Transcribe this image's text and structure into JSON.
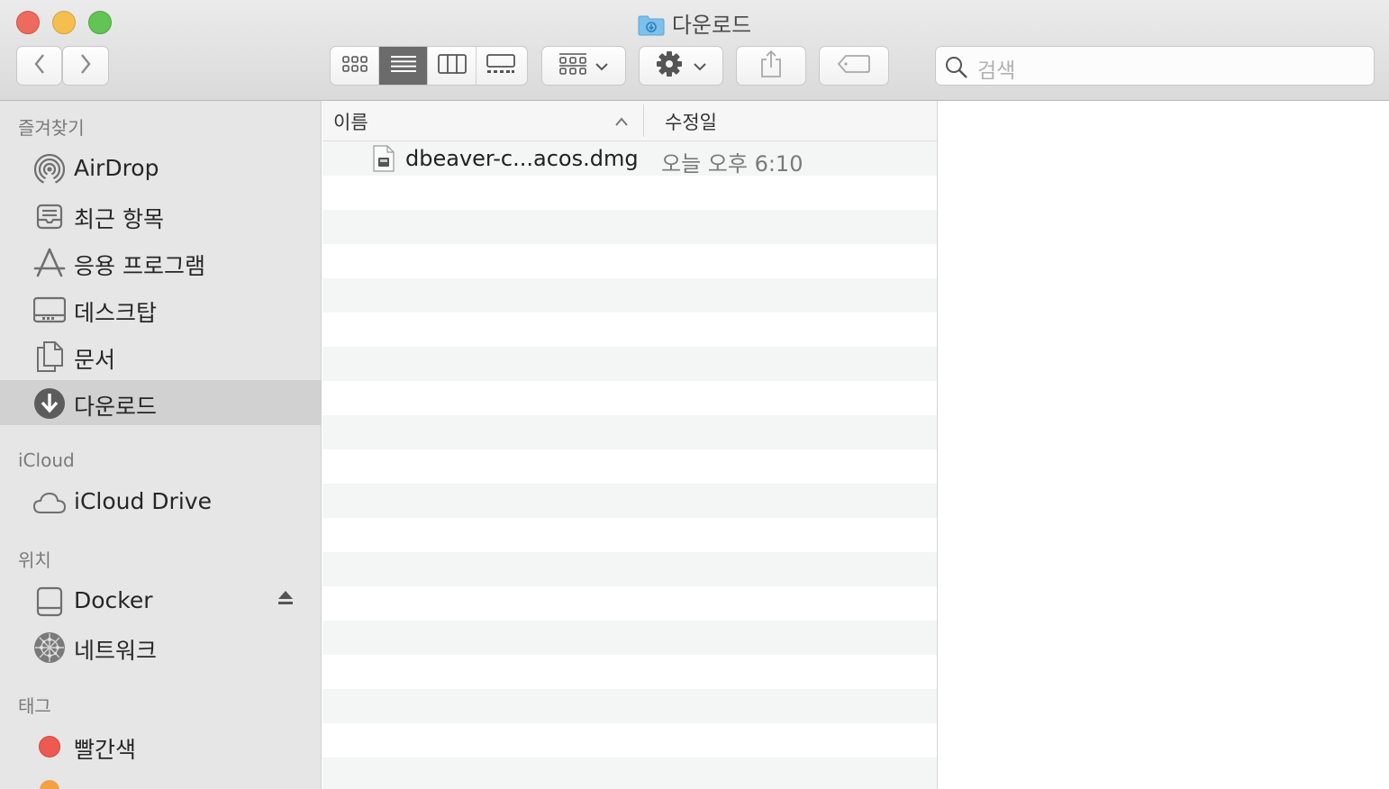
{
  "window": {
    "title": "다운로드"
  },
  "toolbar": {
    "nav": {
      "back_icon": "chevron-left-icon",
      "forward_icon": "chevron-right-icon"
    },
    "view_modes": [
      "icon-view-icon",
      "list-view-icon",
      "column-view-icon",
      "gallery-view-icon"
    ],
    "active_view": "list",
    "search_placeholder": "검색"
  },
  "sidebar": {
    "sections": {
      "favorites": "즐겨찾기",
      "icloud": "iCloud",
      "locations": "위치",
      "tags": "태그"
    },
    "favorites": [
      {
        "label": "AirDrop",
        "icon": "airdrop-icon"
      },
      {
        "label": "최근 항목",
        "icon": "recents-icon"
      },
      {
        "label": "응용 프로그램",
        "icon": "applications-icon"
      },
      {
        "label": "데스크탑",
        "icon": "desktop-icon"
      },
      {
        "label": "문서",
        "icon": "documents-icon"
      },
      {
        "label": "다운로드",
        "icon": "downloads-icon",
        "selected": true
      }
    ],
    "icloud": [
      {
        "label": "iCloud Drive",
        "icon": "cloud-icon"
      }
    ],
    "locations": [
      {
        "label": "Docker",
        "icon": "disk-icon"
      },
      {
        "label": "네트워크",
        "icon": "network-icon"
      }
    ],
    "tags": [
      {
        "label": "빨간색",
        "color": "#ee5a52"
      }
    ]
  },
  "list": {
    "columns": {
      "name": "이름",
      "modified": "수정일"
    },
    "files": [
      {
        "name": "dbeaver-c...acos.dmg",
        "modified": "오늘 오후 6:10",
        "icon": "dmg-file-icon"
      }
    ]
  }
}
